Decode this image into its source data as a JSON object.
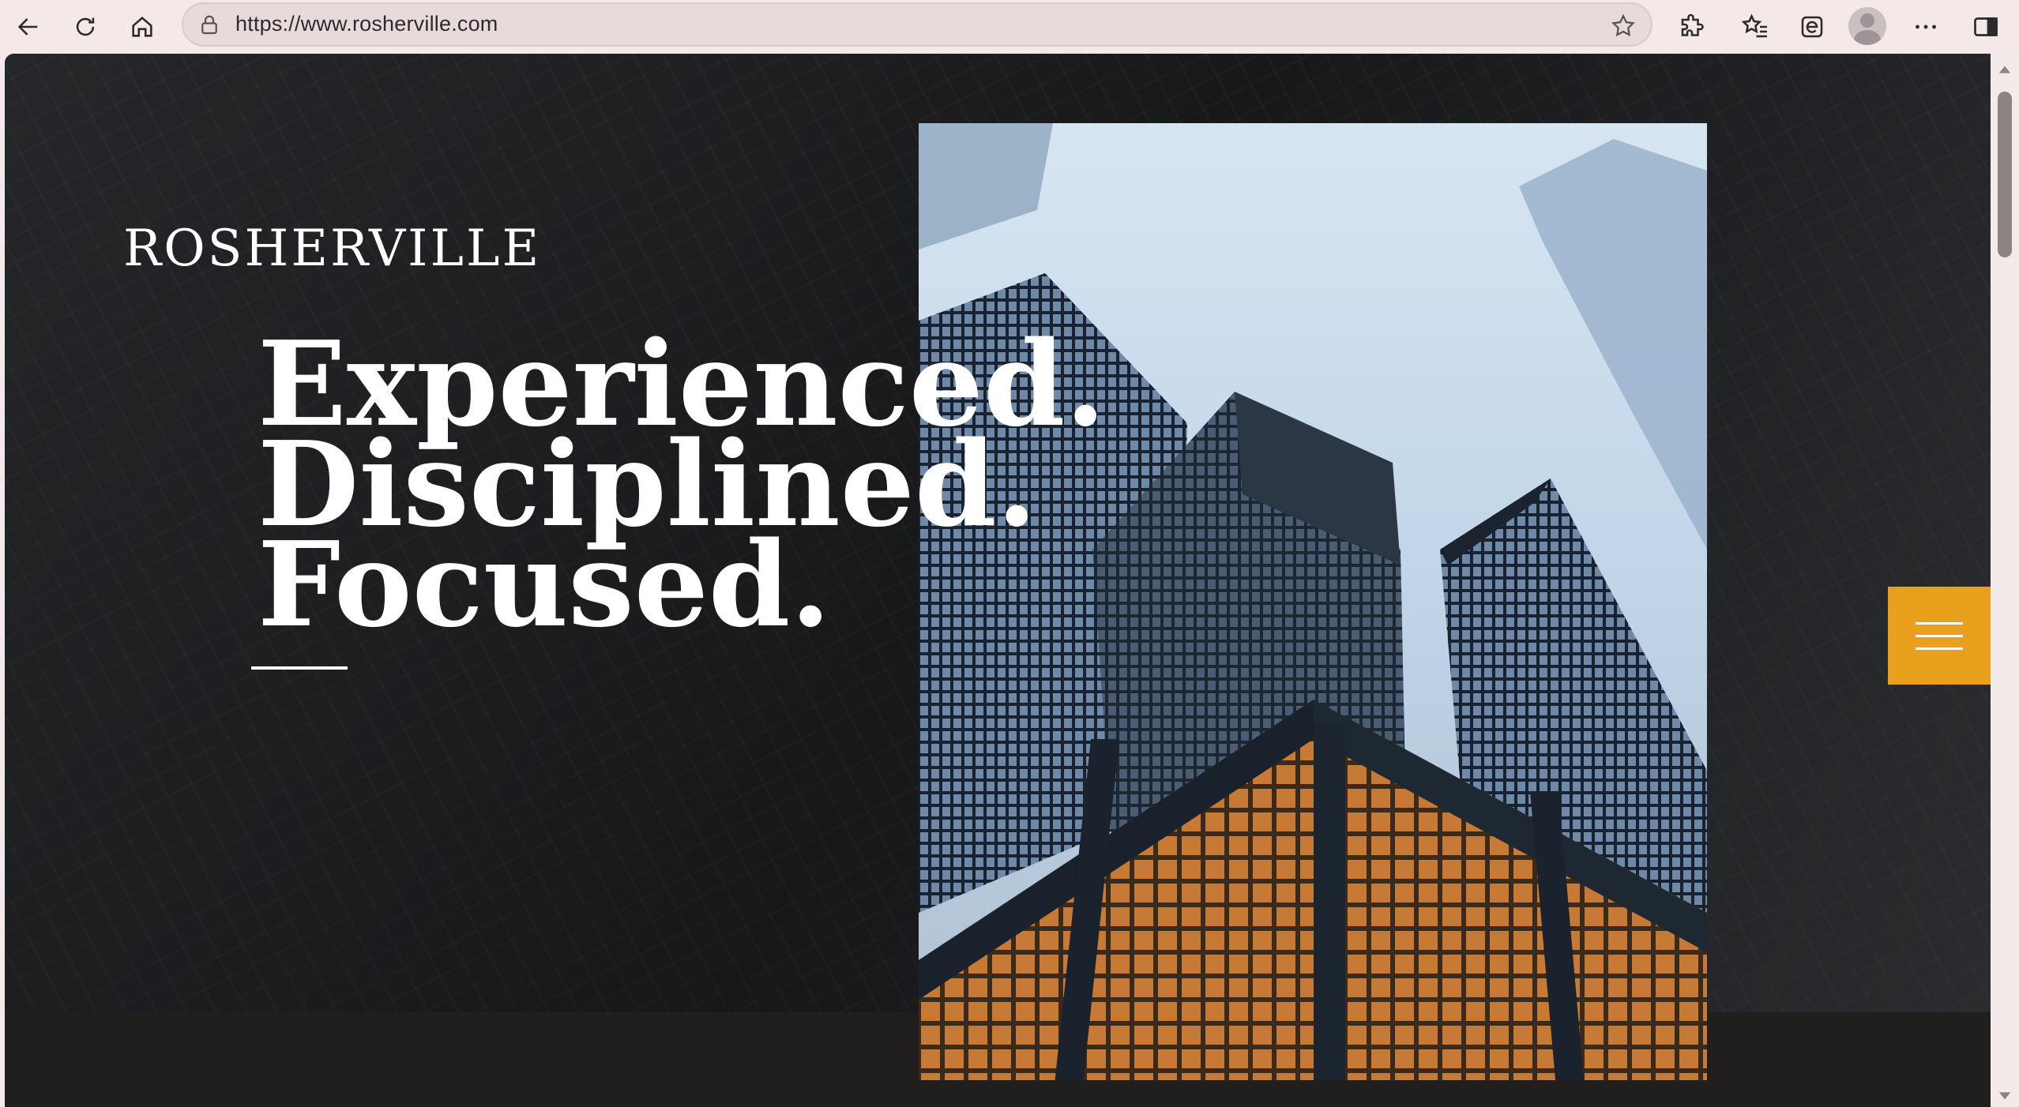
{
  "browser": {
    "url": "https://www.rosherville.com",
    "back_icon": "back-arrow-icon",
    "refresh_icon": "refresh-icon",
    "home_icon": "home-icon"
  },
  "hero": {
    "brand": "ROSHERVILLE",
    "headline_lines": [
      "Experienced.",
      "Disciplined.",
      "Focused."
    ],
    "accent_color": "#e8a01d"
  }
}
